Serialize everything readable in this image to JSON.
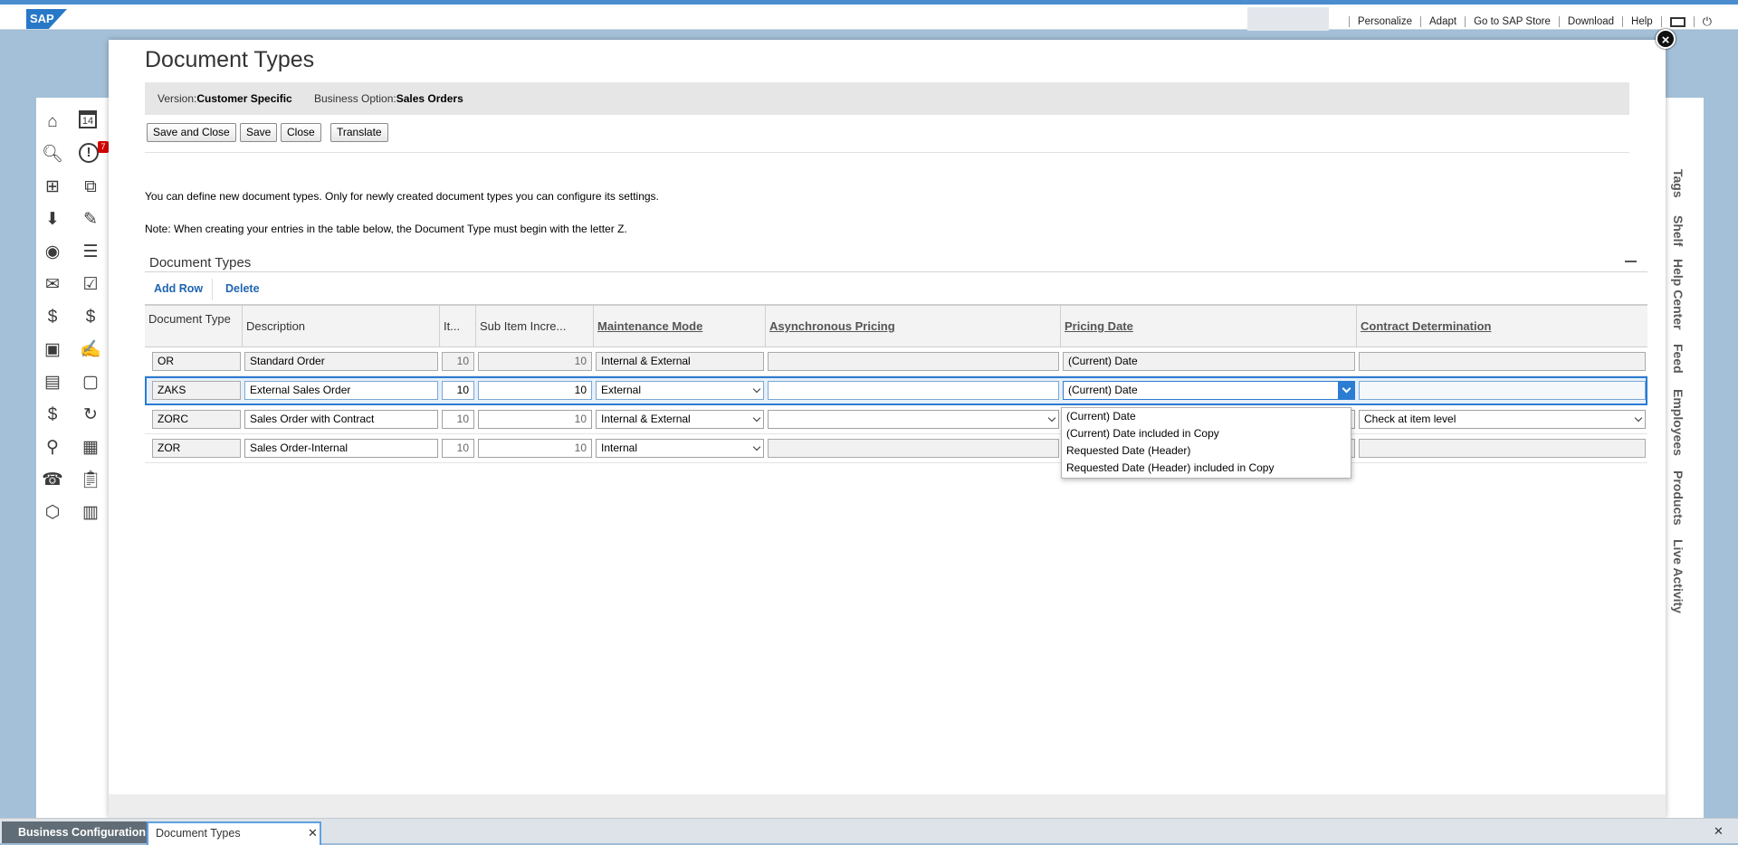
{
  "shell": {
    "logo": "SAP",
    "links": [
      "Personalize",
      "Adapt",
      "Go to SAP Store",
      "Download",
      "Help"
    ]
  },
  "left_nav": {
    "icons": [
      "home-icon",
      "calendar-icon",
      "search-icon",
      "alert-icon",
      "org-chart-icon",
      "boxes-icon",
      "download-icon",
      "analysis-icon",
      "person-icon",
      "people-list-icon",
      "mail-icon",
      "tasks-icon",
      "login-money-icon",
      "coin-icon",
      "person-card-icon",
      "edit-doc-icon",
      "invoice-icon",
      "form-icon",
      "dollar-doc-icon",
      "money-cycle-icon",
      "map-pin-icon",
      "calendar-alt-icon",
      "phone-fax-icon",
      "clipboard-icon",
      "box-icon",
      "documents-icon"
    ],
    "calendar_day": "14",
    "alert_badge": "7"
  },
  "right_tabs": [
    "Tags",
    "Shelf",
    "Help Center",
    "Feed",
    "Employees",
    "Products",
    "Live Activity"
  ],
  "dialog": {
    "title": "Document Types",
    "version_label": "Version:",
    "version_value": "Customer Specific",
    "option_label": "Business Option:",
    "option_value": "Sales Orders",
    "buttons": {
      "save_close": "Save and Close",
      "save": "Save",
      "close": "Close",
      "translate": "Translate"
    },
    "para1": "You can define new document types. Only for newly created document types you can configure its settings.",
    "para2": "Note: When creating your entries in the table below, the Document Type must begin with the letter Z.",
    "section_title": "Document Types",
    "add_row": "Add Row",
    "delete": "Delete"
  },
  "table": {
    "headers": {
      "doc_type": "Document Type",
      "description": "Description",
      "item": "It...",
      "sub_item": "Sub Item Incre...",
      "maint_mode": "Maintenance Mode",
      "async": "Asynchronous Pricing",
      "pricing_date": "Pricing Date",
      "contract": "Contract Determination"
    },
    "rows": [
      {
        "doc_type": "OR",
        "description": "Standard Order",
        "item": "10",
        "sub_item": "10",
        "maint_mode": "Internal & External",
        "async": "",
        "pricing_date": "(Current) Date",
        "contract": ""
      },
      {
        "doc_type": "ZAKS",
        "description": "External Sales Order",
        "item": "10",
        "sub_item": "10",
        "maint_mode": "External",
        "async": "",
        "pricing_date": "(Current) Date",
        "contract": ""
      },
      {
        "doc_type": "ZORC",
        "description": "Sales Order with Contract",
        "item": "10",
        "sub_item": "10",
        "maint_mode": "Internal & External",
        "async": "",
        "pricing_date": "",
        "contract": "Check at item level"
      },
      {
        "doc_type": "ZOR",
        "description": "Sales Order-Internal",
        "item": "10",
        "sub_item": "10",
        "maint_mode": "Internal",
        "async": "",
        "pricing_date": "",
        "contract": ""
      }
    ]
  },
  "pricing_dropdown": {
    "options": [
      "(Current) Date",
      "(Current) Date included in Copy",
      "Requested Date (Header)",
      "Requested Date (Header) included in Copy"
    ]
  },
  "taskbar": {
    "tab1": "Business Configuration",
    "tab2": "Document Types"
  }
}
